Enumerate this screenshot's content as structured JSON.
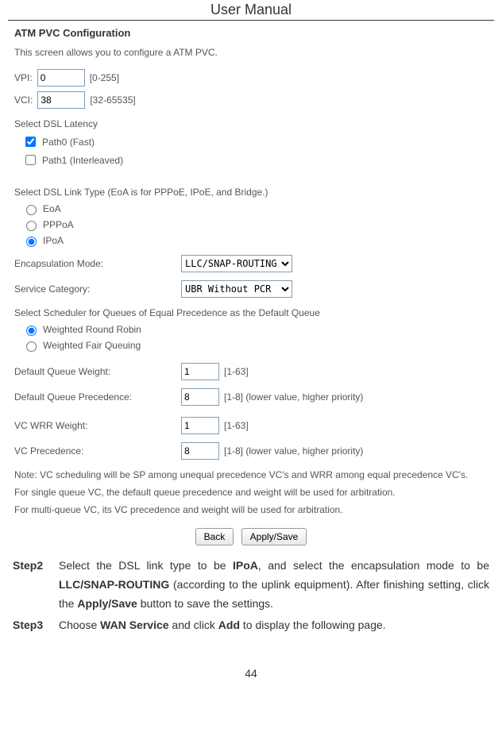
{
  "header": {
    "title": "User Manual"
  },
  "config": {
    "title": "ATM PVC Configuration",
    "intro": "This screen allows you to configure a ATM PVC.",
    "vpi": {
      "label": "VPI:",
      "value": "0",
      "hint": "[0-255]"
    },
    "vci": {
      "label": "VCI:",
      "value": "38",
      "hint": "[32-65535]"
    },
    "latency": {
      "label": "Select DSL Latency",
      "path0": "Path0 (Fast)",
      "path1": "Path1 (Interleaved)"
    },
    "linktype": {
      "label": "Select DSL Link Type (EoA is for PPPoE, IPoE, and Bridge.)",
      "eoa": "EoA",
      "pppoa": "PPPoA",
      "ipoa": "IPoA"
    },
    "encap": {
      "label": "Encapsulation Mode:",
      "value": "LLC/SNAP-ROUTING"
    },
    "svc_cat": {
      "label": "Service Category:",
      "value": "UBR Without PCR"
    },
    "scheduler": {
      "label": "Select Scheduler for Queues of Equal Precedence as the Default Queue",
      "wrr": "Weighted Round Robin",
      "wfq": "Weighted Fair Queuing"
    },
    "dqw": {
      "label": "Default Queue Weight:",
      "value": "1",
      "hint": "[1-63]"
    },
    "dqp": {
      "label": "Default Queue Precedence:",
      "value": "8",
      "hint": "[1-8] (lower value, higher priority)"
    },
    "vcw": {
      "label": "VC WRR Weight:",
      "value": "1",
      "hint": "[1-63]"
    },
    "vcp": {
      "label": "VC Precedence:",
      "value": "8",
      "hint": "[1-8] (lower value, higher priority)"
    },
    "note1": "Note: VC scheduling will be SP among unequal precedence VC's and WRR among equal precedence VC's.",
    "note2": "For single queue VC, the default queue precedence and weight will be used for arbitration.",
    "note3": "For multi-queue VC, its VC precedence and weight will be used for arbitration.",
    "btn_back": "Back",
    "btn_apply": "Apply/Save"
  },
  "steps": {
    "s2_label": "Step2",
    "s2_p1": "Select the DSL link type to be ",
    "s2_b1": "IPoA",
    "s2_p2": ", and select the encapsulation mode to be ",
    "s2_b2": "LLC/SNAP-ROUTING",
    "s2_p3": " (according to the uplink equipment). After finishing setting, click the ",
    "s2_b3": "Apply/Save",
    "s2_p4": " button to save the settings.",
    "s3_label": "Step3",
    "s3_p1": "Choose ",
    "s3_b1": "WAN Service",
    "s3_p2": " and click ",
    "s3_b2": "Add",
    "s3_p3": " to display the following page."
  },
  "page_number": "44"
}
